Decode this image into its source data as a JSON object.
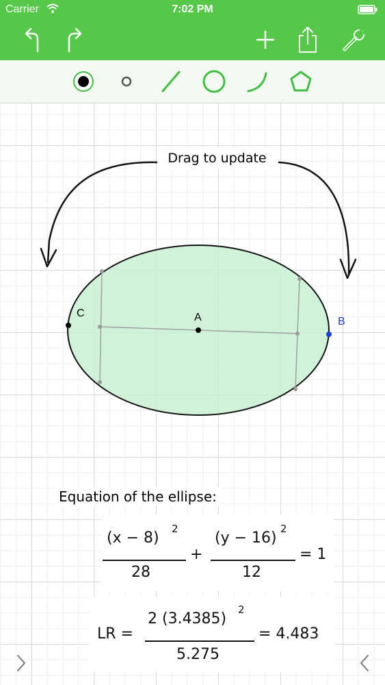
{
  "status_bar": {
    "carrier": "Carrier",
    "time": "7:02 PM"
  },
  "nav_bar": {
    "icons": [
      "undo-icon",
      "redo-icon",
      "add-icon",
      "share-icon",
      "wrench-icon"
    ]
  },
  "toolbar": {
    "tools": [
      "point-tool-selected",
      "point-small-tool",
      "line-tool",
      "circle-tool",
      "arc-tool",
      "polygon-tool"
    ]
  },
  "canvas": {
    "hint": "Drag to update",
    "points": {
      "a": "A",
      "b": "B",
      "c": "C"
    },
    "equation_title": "Equation of the ellipse:",
    "equation": {
      "term1_num": "(x − 8)",
      "term1_exp": "2",
      "term1_den": "28",
      "plus": "+",
      "term2_num": "(y − 16)",
      "term2_exp": "2",
      "term2_den": "12",
      "equals": "= 1"
    },
    "lr": {
      "lhs": "LR =",
      "num": "2 (3.4385)",
      "exp": "2",
      "den": "5.275",
      "result": "= 4.483"
    }
  },
  "colors": {
    "brand_green": "#55c84a",
    "ellipse_fill": "#c8f0d2",
    "point_b_blue": "#1a3fd1"
  }
}
